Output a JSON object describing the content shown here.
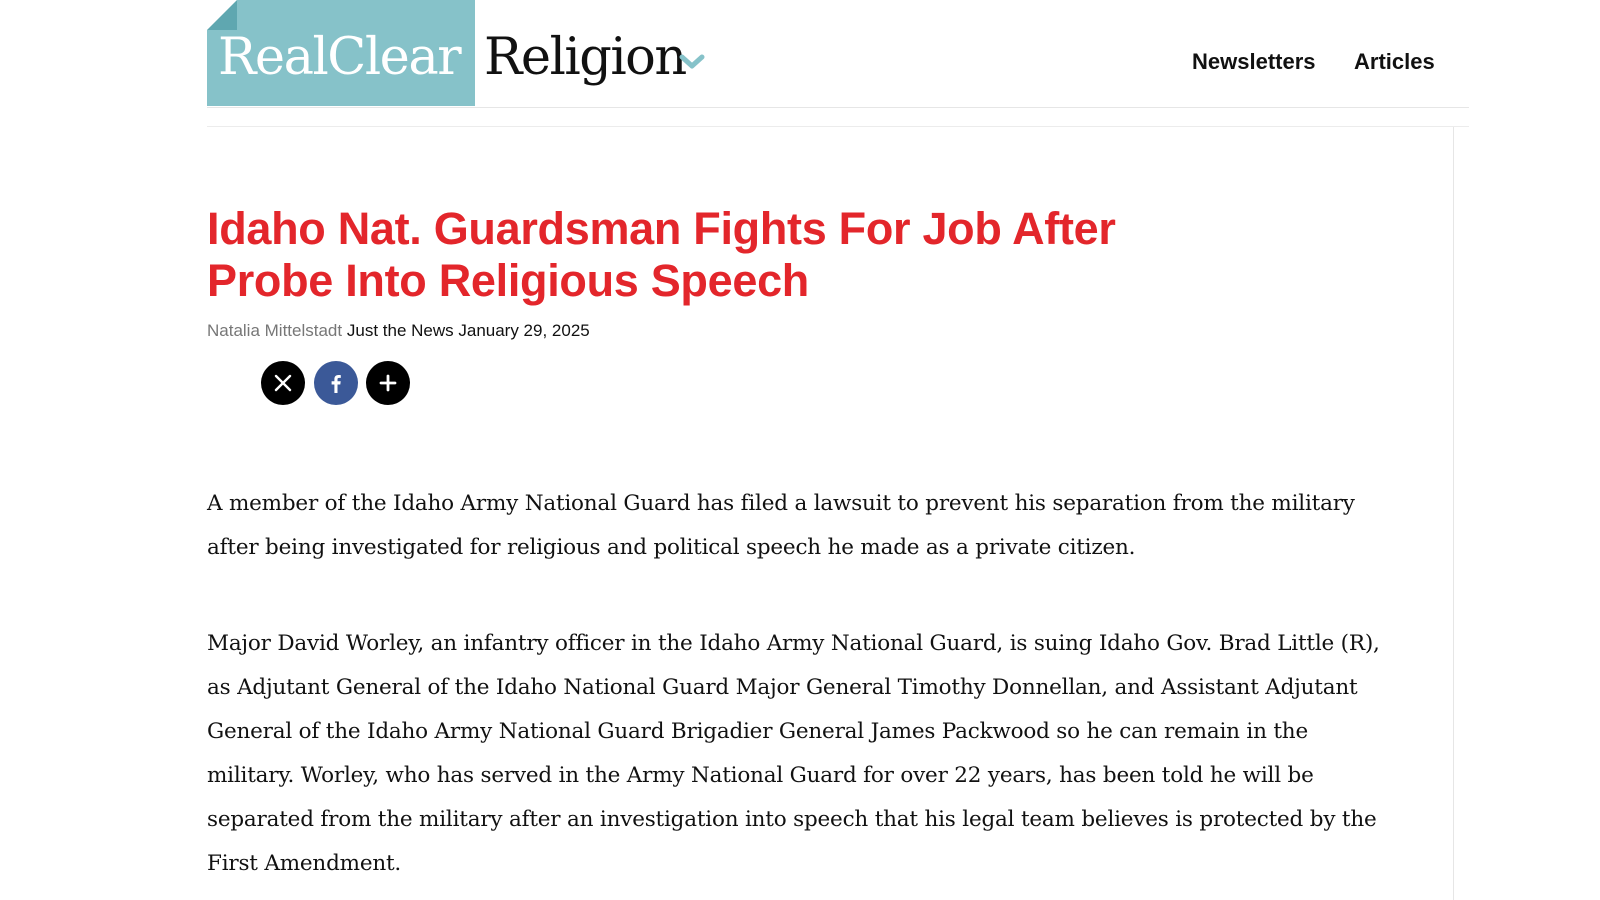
{
  "header": {
    "logo_brand": "RealClear",
    "logo_section": "Religion",
    "nav": [
      {
        "label": "Newsletters"
      },
      {
        "label": "Articles"
      }
    ]
  },
  "article": {
    "headline": "Idaho Nat. Guardsman Fights For Job After Probe Into Religious Speech",
    "author": "Natalia Mittelstadt",
    "source": "Just the News",
    "date": "January 29, 2025",
    "share_icons": [
      "x-icon",
      "facebook-icon",
      "plus-icon"
    ],
    "paragraphs": [
      "A member of the Idaho Army National Guard has filed a lawsuit to prevent his separation from the military after being investigated for religious and political speech he made as a private citizen.",
      "Major David Worley, an infantry officer in the Idaho Army National Guard, is suing Idaho Gov. Brad Little (R), as Adjutant General of the Idaho National Guard Major General Timothy Donnellan, and Assistant Adjutant General of the Idaho Army National Guard Brigadier General James Packwood so he can remain in the military. Worley, who has served in the Army National Guard for over 22 years, has been told he will be separated from the military after an investigation into speech that his legal team believes is protected by the First Amendment."
    ]
  },
  "colors": {
    "logo_bg": "#86c2c9",
    "headline": "#e3262b",
    "facebook": "#3b5998"
  }
}
